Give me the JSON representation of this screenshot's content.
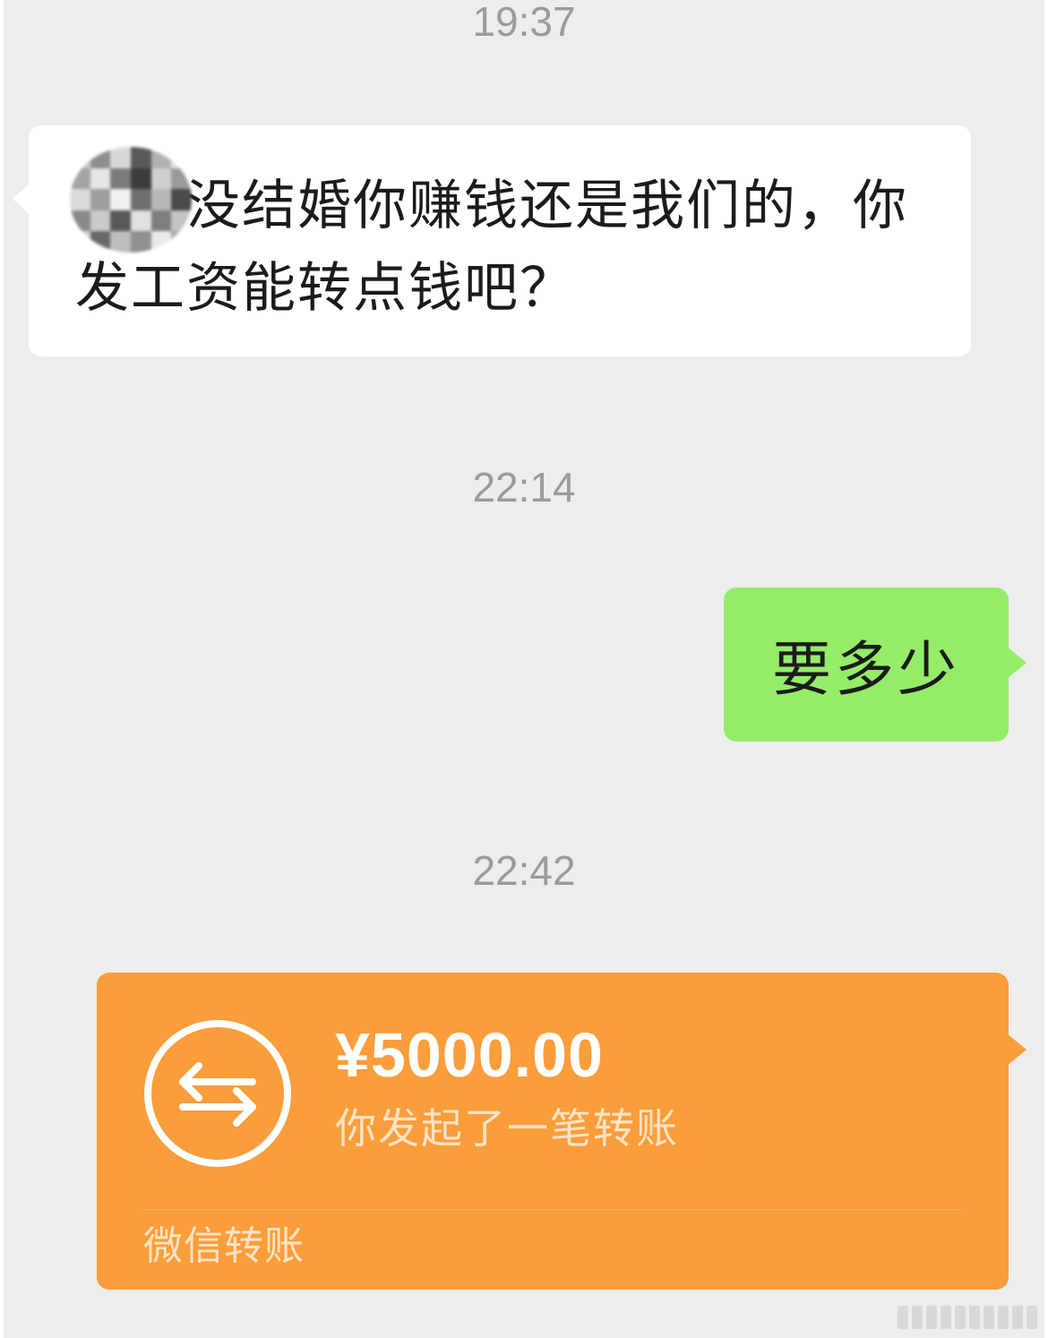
{
  "timestamps": {
    "first": "19:37",
    "second": "22:14",
    "third": "22:42"
  },
  "incoming_message": {
    "text": "都你没结婚你赚钱还是我们的，你发工资能转点钱吧？"
  },
  "outgoing_message": {
    "text": "要多少"
  },
  "transfer": {
    "amount": "¥5000.00",
    "description": "你发起了一笔转账",
    "footer": "微信转账",
    "icon": "transfer-arrows-icon"
  },
  "colors": {
    "background": "#ededed",
    "incoming_bubble": "#ffffff",
    "outgoing_bubble": "#95ec69",
    "transfer_card": "#fa9d3b",
    "timestamp": "#9b9b9b"
  }
}
